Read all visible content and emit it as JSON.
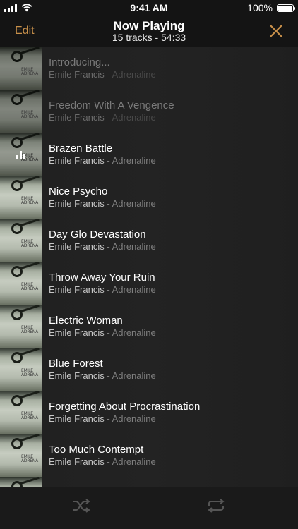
{
  "status_bar": {
    "time": "9:41 AM",
    "battery": "100%",
    "signal_icon": "cellular-signal-icon",
    "wifi_icon": "wifi-icon",
    "battery_icon": "battery-icon"
  },
  "nav": {
    "edit_label": "Edit",
    "title": "Now Playing",
    "subtitle": "15 tracks - 54:33",
    "close_icon": "close-icon",
    "accent_color": "#c8904a"
  },
  "tracks": [
    {
      "title": "Introducing...",
      "artist": "Emile Francis",
      "separator": " - ",
      "album": "Adrenaline",
      "state": "played",
      "art_text": "EMILE\nADRENA"
    },
    {
      "title": "Freedom With A Vengence",
      "artist": "Emile Francis",
      "separator": " - ",
      "album": "Adrenaline",
      "state": "played",
      "art_text": "EMILE\nADRENA"
    },
    {
      "title": "Brazen Battle",
      "artist": "Emile Francis",
      "separator": " - ",
      "album": "Adrenaline",
      "state": "playing",
      "art_text": "EMILE\nADRENA"
    },
    {
      "title": "Nice Psycho",
      "artist": "Emile Francis",
      "separator": " - ",
      "album": "Adrenaline",
      "state": "upcoming",
      "art_text": "EMILE\nADRENA"
    },
    {
      "title": "Day Glo Devastation",
      "artist": "Emile Francis",
      "separator": " - ",
      "album": "Adrenaline",
      "state": "upcoming",
      "art_text": "EMILE\nADRENA"
    },
    {
      "title": "Throw Away Your Ruin",
      "artist": "Emile Francis",
      "separator": " - ",
      "album": "Adrenaline",
      "state": "upcoming",
      "art_text": "EMILE\nADRENA"
    },
    {
      "title": "Electric Woman",
      "artist": "Emile Francis",
      "separator": " - ",
      "album": "Adrenaline",
      "state": "upcoming",
      "art_text": "EMILE\nADRENA"
    },
    {
      "title": "Blue Forest",
      "artist": "Emile Francis",
      "separator": " - ",
      "album": "Adrenaline",
      "state": "upcoming",
      "art_text": "EMILE\nADRENA"
    },
    {
      "title": "Forgetting About Procrastination",
      "artist": "Emile Francis",
      "separator": " - ",
      "album": "Adrenaline",
      "state": "upcoming",
      "art_text": "EMILE\nADRENA"
    },
    {
      "title": "Too Much Contempt",
      "artist": "Emile Francis",
      "separator": " - ",
      "album": "Adrenaline",
      "state": "upcoming",
      "art_text": "EMILE\nADRENA"
    }
  ],
  "toolbar": {
    "shuffle_icon": "shuffle-icon",
    "repeat_icon": "repeat-icon",
    "icon_color": "#555555"
  }
}
